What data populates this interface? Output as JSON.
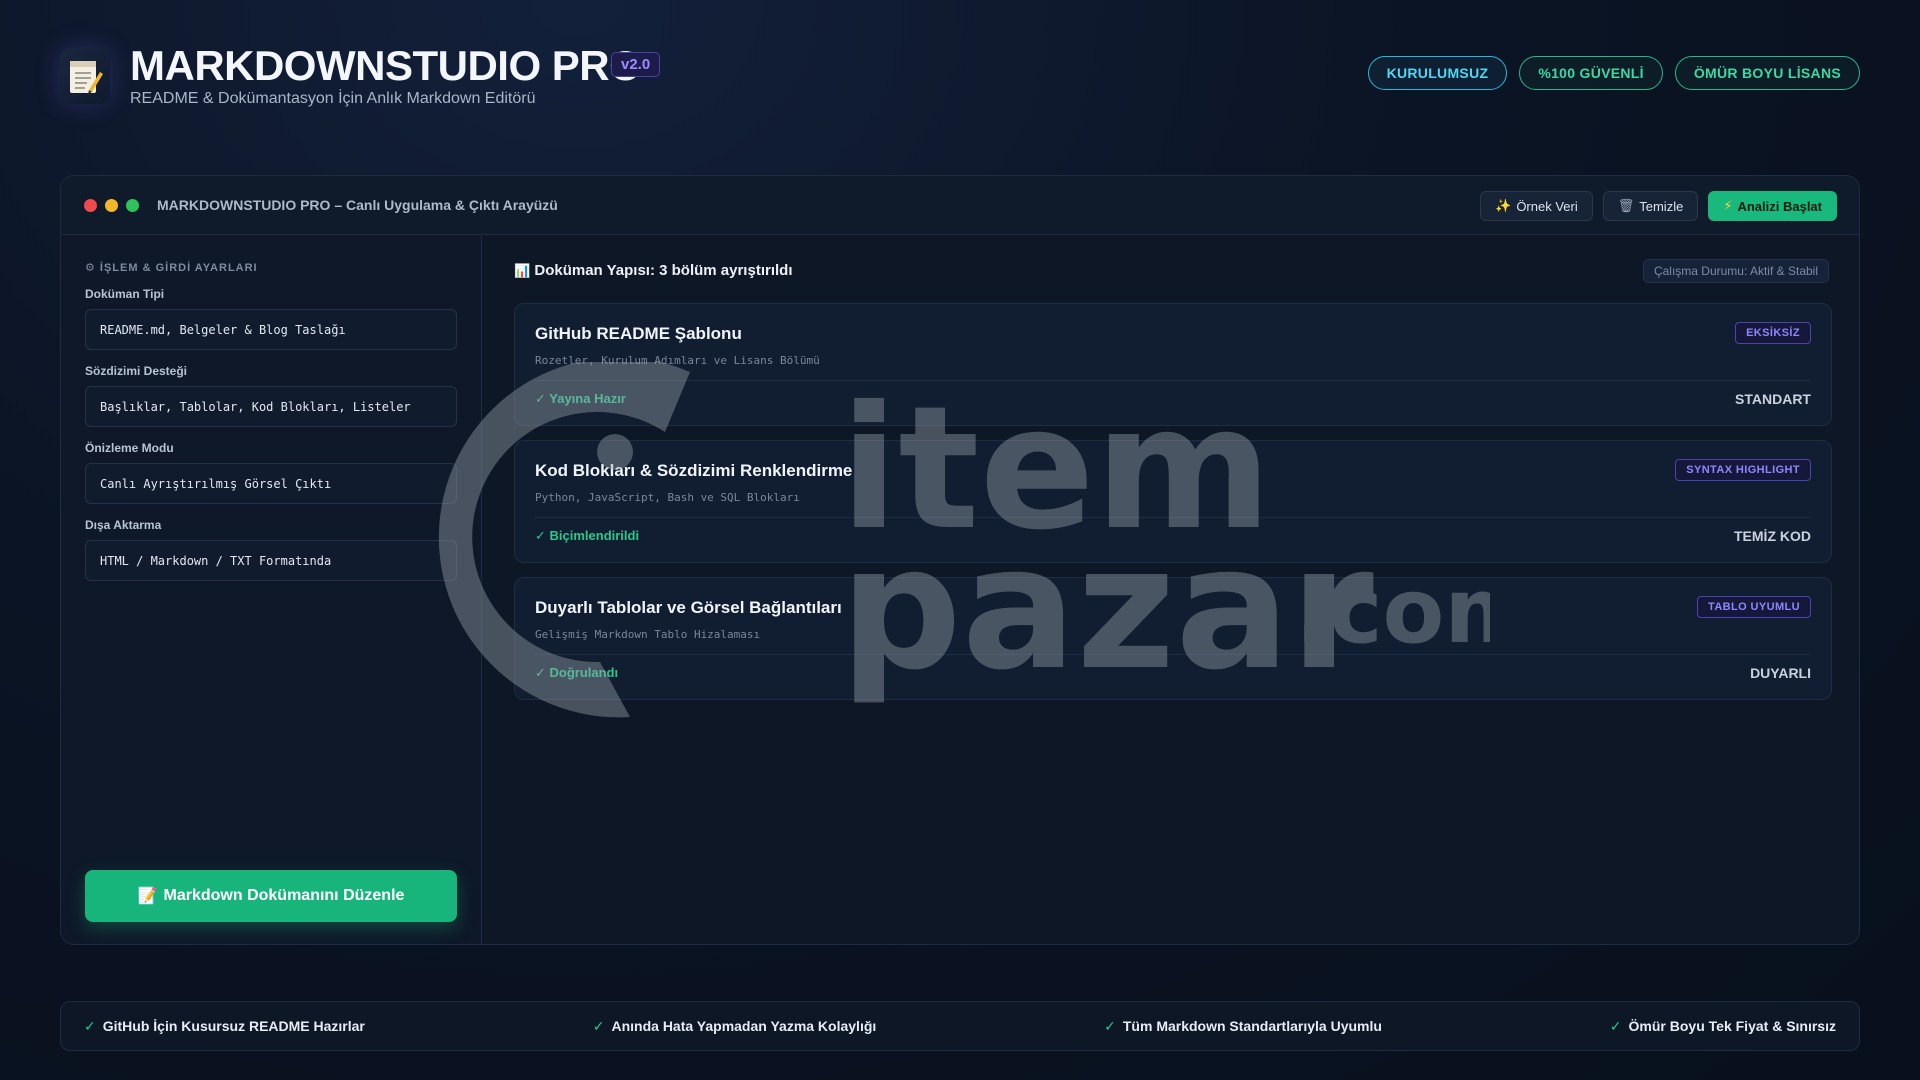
{
  "header": {
    "title": "MARKDOWNSTUDIO PRO",
    "version": "v2.0",
    "subtitle": "README & Dokümantasyon İçin Anlık Markdown Editörü",
    "badges": [
      "KURULUMSUZ",
      "%100 GÜVENLİ",
      "ÖMÜR BOYU LİSANS"
    ]
  },
  "window": {
    "title": "MARKDOWNSTUDIO PRO – Canlı Uygulama & Çıktı Arayüzü",
    "buttons": {
      "sample": "Örnek Veri",
      "clear": "Temizle",
      "analyze": "Analizi Başlat"
    }
  },
  "left": {
    "section_title": "⚙ İŞLEM & GİRDİ AYARLARI",
    "fields": [
      {
        "label": "Doküman Tipi",
        "value": "README.md, Belgeler & Blog Taslağı"
      },
      {
        "label": "Sözdizimi Desteği",
        "value": "Başlıklar, Tablolar, Kod Blokları, Listeler"
      },
      {
        "label": "Önizleme Modu",
        "value": "Canlı Ayrıştırılmış Görsel Çıktı"
      },
      {
        "label": "Dışa Aktarma",
        "value": "HTML / Markdown / TXT Formatında"
      }
    ],
    "edit_button": "Markdown Dokümanını Düzenle"
  },
  "right": {
    "structure_title": "Doküman Yapısı: 3 bölüm ayrıştırıldı",
    "status": "Çalışma Durumu: Aktif & Stabil",
    "cards": [
      {
        "title": "GitHub README Şablonu",
        "subtitle": "Rozetler, Kurulum Adımları ve Lisans Bölümü",
        "tag": "EKSİKSİZ",
        "status": "✓ Yayına Hazır",
        "right_label": "STANDART"
      },
      {
        "title": "Kod Blokları & Sözdizimi Renklendirme",
        "subtitle": "Python, JavaScript, Bash ve SQL Blokları",
        "tag": "SYNTAX HIGHLIGHT",
        "status": "✓ Biçimlendirildi",
        "right_label": "TEMİZ KOD"
      },
      {
        "title": "Duyarlı Tablolar ve Görsel Bağlantıları",
        "subtitle": "Gelişmiş Markdown Tablo Hizalaması",
        "tag": "TABLO UYUMLU",
        "status": "✓ Doğrulandı",
        "right_label": "DUYARLI"
      }
    ]
  },
  "watermark": {
    "line1": "item",
    "line2": "pazar",
    "suffix": ".com"
  },
  "footer": {
    "features": [
      "GitHub İçin Kusursuz README Hazırlar",
      "Anında Hata Yapmadan Yazma Kolaylığı",
      "Tüm Markdown Standartlarıyla Uyumlu",
      "Ömür Boyu Tek Fiyat & Sınırsız"
    ]
  },
  "colors": {
    "accent_green": "#17b57b",
    "accent_purple": "#8f86ff",
    "accent_cyan": "#4fd8f5"
  }
}
